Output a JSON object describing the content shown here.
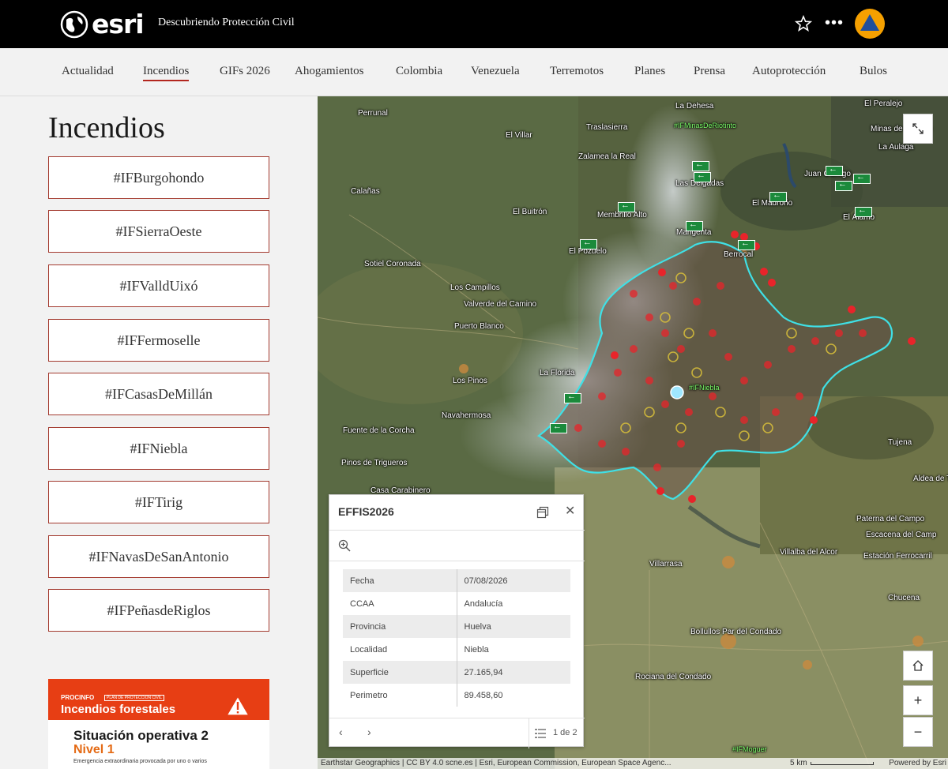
{
  "header": {
    "logo_text": "esri",
    "site_title": "Descubriendo Protección Civil",
    "icons": [
      "globe-icon",
      "star-icon",
      "more-icon"
    ],
    "avatar_color": "#f5a000"
  },
  "nav": {
    "items": [
      "Actualidad",
      "Incendios",
      "GIFs 2026",
      "Ahogamientos",
      "Colombia",
      "Venezuela",
      "Terremotos",
      "Planes",
      "Prensa",
      "Autoprotección",
      "Bulos"
    ],
    "active": "Incendios"
  },
  "left_panel": {
    "title": "Incendios",
    "tags": [
      "#IFBurgohondo",
      "#IFSierraOeste",
      "#IFValldUixó",
      "#IFFermoselle",
      "#IFCasasDeMillán",
      "#IFNiebla",
      "#IFTirig",
      "#IFNavasDeSanAntonio",
      "#IFPeñasdeRiglos"
    ],
    "banner": {
      "brand": "PROCINFO",
      "subbrand": "PLAN DE PROTECCIÓN CIVIL",
      "title": "Incendios forestales",
      "heading": "Situación operativa 2",
      "level": "Nivel 1",
      "small_text": "Emergencia extraordinaria provocada por uno o varios",
      "accent_color": "#e73e14"
    }
  },
  "map": {
    "place_names": [
      "La Dehesa",
      "El Peralejo",
      "Perrunal",
      "Traslasierra",
      "Minas de Ríotinto",
      "El Villar",
      "La Aulaga",
      "Zalamea la Real",
      "Juan Gallego",
      "Las Delgadas",
      "Calañas",
      "El Madroño",
      "El Buitrón",
      "Membrillo Alto",
      "El Álamo",
      "Marigenta",
      "El Pozuelo",
      "Berrocal",
      "Sotiel Coronada",
      "Los Campillos",
      "Valverde del Camino",
      "Puerto Blanco",
      "La Florida",
      "Los Pinos",
      "Navahermosa",
      "Fuente de la Corcha",
      "Tujena",
      "Pinos de Trigueros",
      "Aldea de T",
      "Casa Carabinero",
      "Paterna del Campo",
      "Escacena del Camp",
      "Villalba del Alcor",
      "Estación Ferrocarril",
      "Villarrasa",
      "Chucena",
      "Bollullos Par del Condado",
      "Rociana del Condado"
    ],
    "fire_labels": [
      "#IFMinasDeRiotinto",
      "#IFNiebla",
      "#IFMoguer"
    ],
    "attribution": "Earthstar Geographics | CC BY 4.0 scne.es | Esri, European Commission, European Space Agenc...",
    "scale": "5 km",
    "powered_by": "Powered by Esri",
    "perimeter_color": "#3fe0e6",
    "hotspot_color": "#e8242a",
    "buttons": [
      "expand-icon",
      "home-icon",
      "zoom-in-icon",
      "zoom-out-icon"
    ]
  },
  "popup": {
    "title": "EFFIS2026",
    "rows": [
      {
        "key": "Fecha",
        "value": "07/08/2026"
      },
      {
        "key": "CCAA",
        "value": "Andalucía"
      },
      {
        "key": "Provincia",
        "value": "Huelva"
      },
      {
        "key": "Localidad",
        "value": "Niebla"
      },
      {
        "key": "Superficie",
        "value": "27.165,94"
      },
      {
        "key": "Perimetro",
        "value": "89.458,60"
      }
    ],
    "pagination": "1 de 2"
  }
}
